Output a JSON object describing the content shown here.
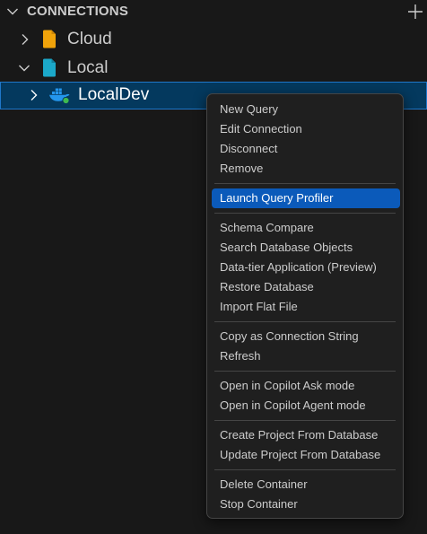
{
  "header": {
    "title": "CONNECTIONS",
    "expand_icon": "chevron-down-icon",
    "add_icon": "plus-icon"
  },
  "tree": {
    "cloud": {
      "label": "Cloud",
      "icon": "file-icon",
      "icon_color": "#f0a30a",
      "expanded": false
    },
    "local": {
      "label": "Local",
      "icon": "file-icon",
      "icon_color": "#1ba8c9",
      "expanded": true
    },
    "localdev": {
      "label": "LocalDev",
      "icon": "docker-icon",
      "status_color": "#3fb950",
      "expanded": false
    }
  },
  "context_menu": {
    "groups": [
      [
        "New Query",
        "Edit Connection",
        "Disconnect",
        "Remove"
      ],
      [
        "Launch Query Profiler"
      ],
      [
        "Schema Compare",
        "Search Database Objects",
        "Data-tier Application (Preview)",
        "Restore Database",
        "Import Flat File"
      ],
      [
        "Copy as Connection String",
        "Refresh"
      ],
      [
        "Open in Copilot Ask mode",
        "Open in Copilot Agent mode"
      ],
      [
        "Create Project From Database",
        "Update Project From Database"
      ],
      [
        "Delete Container",
        "Stop Container"
      ]
    ],
    "highlighted": "Launch Query Profiler",
    "highlight_color": "#0b5aba"
  }
}
